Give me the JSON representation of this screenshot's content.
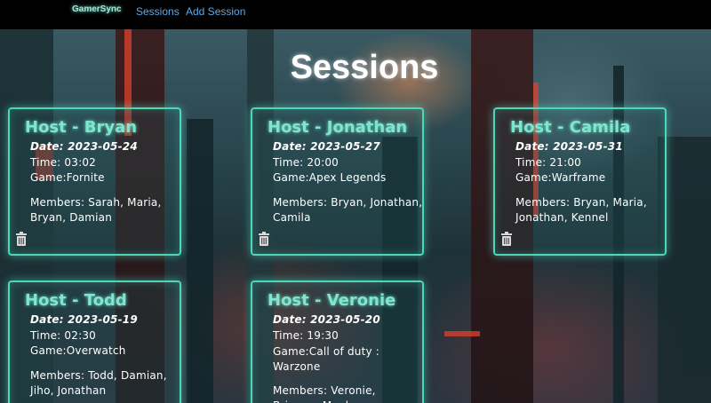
{
  "nav": {
    "brand": "GamerSync",
    "links": [
      "Sessions",
      "Add Session"
    ]
  },
  "page": {
    "title": "Sessions"
  },
  "sessions": [
    {
      "host": "Host - Bryan",
      "date": "Date: 2023-05-24",
      "time": "Time: 03:02",
      "game": "Game:Fornite",
      "members": "Members: Sarah, Maria, Bryan, Damian"
    },
    {
      "host": "Host - Jonathan",
      "date": "Date: 2023-05-27",
      "time": "Time: 20:00",
      "game": "Game:Apex Legends",
      "members": "Members: Bryan, Jonathan, Camila"
    },
    {
      "host": "Host - Camila",
      "date": "Date: 2023-05-31",
      "time": "Time: 21:00",
      "game": "Game:Warframe",
      "members": "Members: Bryan, Maria, Jonathan, Kennel"
    },
    {
      "host": "Host - Todd",
      "date": "Date: 2023-05-19",
      "time": "Time: 02:30",
      "game": "Game:Overwatch",
      "members": "Members: Todd, Damian, Jiho, Jonathan"
    },
    {
      "host": "Host - Veronie",
      "date": "Date: 2023-05-20",
      "time": "Time: 19:30",
      "game": "Game:Call of duty : Warzone",
      "members": "Members: Veronie, Brianna, Meghan"
    }
  ],
  "colors": {
    "accent": "#4fd6b8",
    "host_text": "#7ee6cf",
    "nav_link": "#5fa8e6",
    "navbar_bg": "#000000"
  },
  "icons": {
    "delete": "trash-icon"
  }
}
